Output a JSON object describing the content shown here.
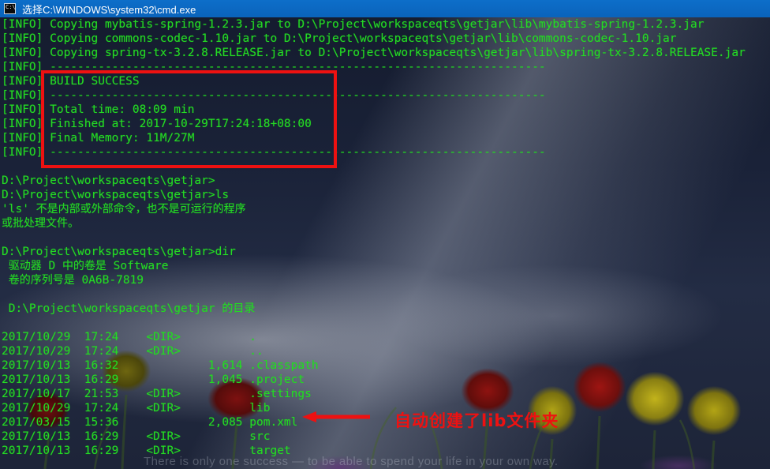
{
  "window": {
    "title": "选择C:\\WINDOWS\\system32\\cmd.exe",
    "icon": "cmd-icon",
    "icon_glyph": "C:\\"
  },
  "theme": {
    "title_bar_bg": "#0a63bb",
    "console_text": "#25d925",
    "annotation_red": "#ee1111",
    "wallpaper_sky": "#1a2238"
  },
  "desktop": {
    "watermark": "There is only one success — to be able to spend your life in your own way."
  },
  "annotation": {
    "text": "自动创建了lib文件夹",
    "arrow": "left-arrow",
    "box_label": "build-success-highlight"
  },
  "console": {
    "lines": [
      {
        "id": "copy-mybatis",
        "text": "[INFO] Copying mybatis-spring-1.2.3.jar to D:\\Project\\workspaceqts\\getjar\\lib\\mybatis-spring-1.2.3.jar"
      },
      {
        "id": "copy-codec",
        "text": "[INFO] Copying commons-codec-1.10.jar to D:\\Project\\workspaceqts\\getjar\\lib\\commons-codec-1.10.jar"
      },
      {
        "id": "copy-springtx",
        "text": "[INFO] Copying spring-tx-3.2.8.RELEASE.jar to D:\\Project\\workspaceqts\\getjar\\lib\\spring-tx-3.2.8.RELEASE.jar"
      },
      {
        "id": "rule-1",
        "text": "[INFO] ------------------------------------------------------------------------"
      },
      {
        "id": "build-success",
        "text": "[INFO] BUILD SUCCESS"
      },
      {
        "id": "rule-2",
        "text": "[INFO] ------------------------------------------------------------------------"
      },
      {
        "id": "total-time",
        "text": "[INFO] Total time: 08:09 min"
      },
      {
        "id": "finished-at",
        "text": "[INFO] Finished at: 2017-10-29T17:24:18+08:00"
      },
      {
        "id": "final-memory",
        "text": "[INFO] Final Memory: 11M/27M"
      },
      {
        "id": "rule-3",
        "text": "[INFO] ------------------------------------------------------------------------"
      },
      {
        "id": "blank-1",
        "text": ""
      },
      {
        "id": "prompt-1",
        "text": "D:\\Project\\workspaceqts\\getjar>"
      },
      {
        "id": "prompt-ls",
        "text": "D:\\Project\\workspaceqts\\getjar>ls"
      },
      {
        "id": "ls-error-1",
        "text": "'ls' 不是内部或外部命令，也不是可运行的程序"
      },
      {
        "id": "ls-error-2",
        "text": "或批处理文件。"
      },
      {
        "id": "blank-2",
        "text": ""
      },
      {
        "id": "prompt-dir",
        "text": "D:\\Project\\workspaceqts\\getjar>dir"
      },
      {
        "id": "volume-label",
        "text": " 驱动器 D 中的卷是 Software"
      },
      {
        "id": "volume-serial",
        "text": " 卷的序列号是 0A6B-7819"
      },
      {
        "id": "blank-3",
        "text": ""
      },
      {
        "id": "dir-header",
        "text": " D:\\Project\\workspaceqts\\getjar 的目录"
      },
      {
        "id": "blank-4",
        "text": ""
      },
      {
        "id": "row-dot",
        "text": "2017/10/29  17:24    <DIR>          ."
      },
      {
        "id": "row-dotdot",
        "text": "2017/10/29  17:24    <DIR>          .."
      },
      {
        "id": "row-classpath",
        "text": "2017/10/13  16:32             1,614 .classpath"
      },
      {
        "id": "row-project",
        "text": "2017/10/13  16:29             1,045 .project"
      },
      {
        "id": "row-settings",
        "text": "2017/10/17  21:53    <DIR>          .settings"
      },
      {
        "id": "row-lib",
        "text": "2017/10/29  17:24    <DIR>          lib"
      },
      {
        "id": "row-pom",
        "text": "2017/03/15  15:36             2,085 pom.xml"
      },
      {
        "id": "row-src",
        "text": "2017/10/13  16:29    <DIR>          src"
      },
      {
        "id": "row-target",
        "text": "2017/10/13  16:29    <DIR>          target"
      }
    ]
  }
}
